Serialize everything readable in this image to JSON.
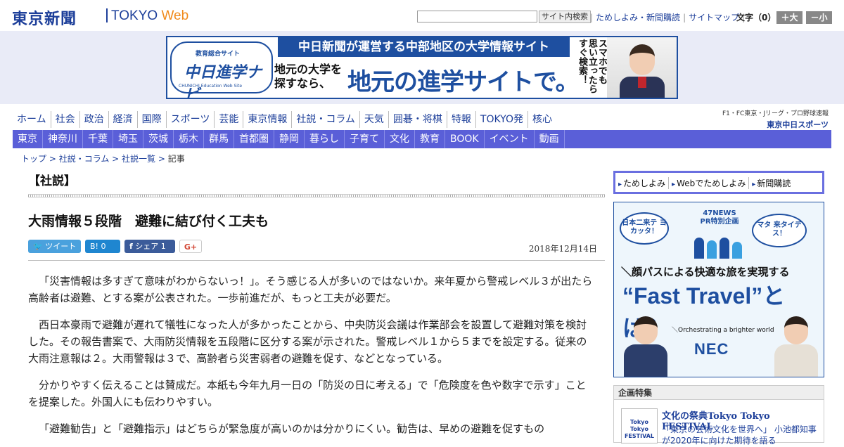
{
  "header": {
    "logo_jp": "東京新聞",
    "logo_en_1": "TOKYO",
    "logo_en_2": "Web",
    "search_button": "サイト内検索",
    "util_links": [
      "ためしよみ・新聞購読",
      "サイトマップ"
    ],
    "font_label": "文字（0）",
    "font_up": "＋大",
    "font_down": "－小"
  },
  "banner": {
    "logo_top": "教育総合サイト",
    "logo_main": "中日進学ナビ",
    "logo_sub": "CHUNICHI Education Web Site",
    "bar": "中日新聞が運営する中部地区の大学情報サイト",
    "lead": "地元の大学を 探すなら、",
    "big": "地元の進学サイトで。",
    "vertical": "スマホでも 思い立ったら すぐ検索！"
  },
  "global_nav": [
    "ホーム",
    "社会",
    "政治",
    "経済",
    "国際",
    "スポーツ",
    "芸能",
    "東京情報",
    "社説・コラム",
    "天気",
    "囲碁・将棋",
    "特報",
    "TOKYO発",
    "核心"
  ],
  "sports_link": {
    "line1": "F1・FC東京・Jリーグ・プロ野球速報",
    "line2": "東京中日スポーツ"
  },
  "sub_nav": [
    "東京",
    "神奈川",
    "千葉",
    "埼玉",
    "茨城",
    "栃木",
    "群馬",
    "首都圏",
    "静岡",
    "暮らし",
    "子育て",
    "文化",
    "教育",
    "BOOK",
    "イベント",
    "動画"
  ],
  "breadcrumb": {
    "items": [
      "トップ",
      "社説・コラム",
      "社説一覧"
    ],
    "current": "記事"
  },
  "article": {
    "section": "【社説】",
    "headline": "大雨情報５段階　避難に結び付く工夫も",
    "date": "2018年12月14日",
    "share": {
      "tweet": "ツイート",
      "hatena": "B! 0",
      "facebook": "シェア 1",
      "gplus": "G+"
    },
    "paragraphs": [
      "「災害情報は多すぎて意味がわからないっ！」。そう感じる人が多いのではないか。来年夏から警戒レベル３が出たら高齢者は避難、とする案が公表された。一歩前進だが、もっと工夫が必要だ。",
      "西日本豪雨で避難が遅れて犠牲になった人が多かったことから、中央防災会議は作業部会を設置して避難対策を検討した。その報告書案で、大雨防災情報を五段階に区分する案が示された。警戒レベル１から５までを設定する。従来の大雨注意報は２。大雨警報は３で、高齢者ら災害弱者の避難を促す、などとなっている。",
      "分かりやすく伝えることは賛成だ。本紙も今年九月一日の「防災の日に考える」で「危険度を色や数字で示す」ことを提案した。外国人にも伝わりやすい。",
      "「避難勧告」と「避難指示」はどちらが緊急度が高いのかは分かりにくい。勧告は、早めの避難を促すもの"
    ]
  },
  "sidebar": {
    "subscribe_links": [
      "ためしよみ",
      "Webでためしよみ",
      "新聞購読"
    ],
    "nec_ad": {
      "bubble_left": "日本二来テ ヨカッタ！",
      "bubble_right": "マタ 来タイデス！",
      "pr": "47NEWS PR特別企画",
      "sub": "＼顔パスによる快適な旅を実現する",
      "big": "“Fast Travel”とは？",
      "orchestrating": "＼Orchestrating a brighter world",
      "logo": "NEC"
    },
    "kikaku": {
      "header": "企画特集",
      "thumb": "Tokyo Tokyo FESTIVAL",
      "title": "文化の祭典Tokyo Tokyo FESTIVAL",
      "text": "「東京の芸術文化を世界へ」 小池都知事が2020年に向けた期待を語る"
    }
  }
}
